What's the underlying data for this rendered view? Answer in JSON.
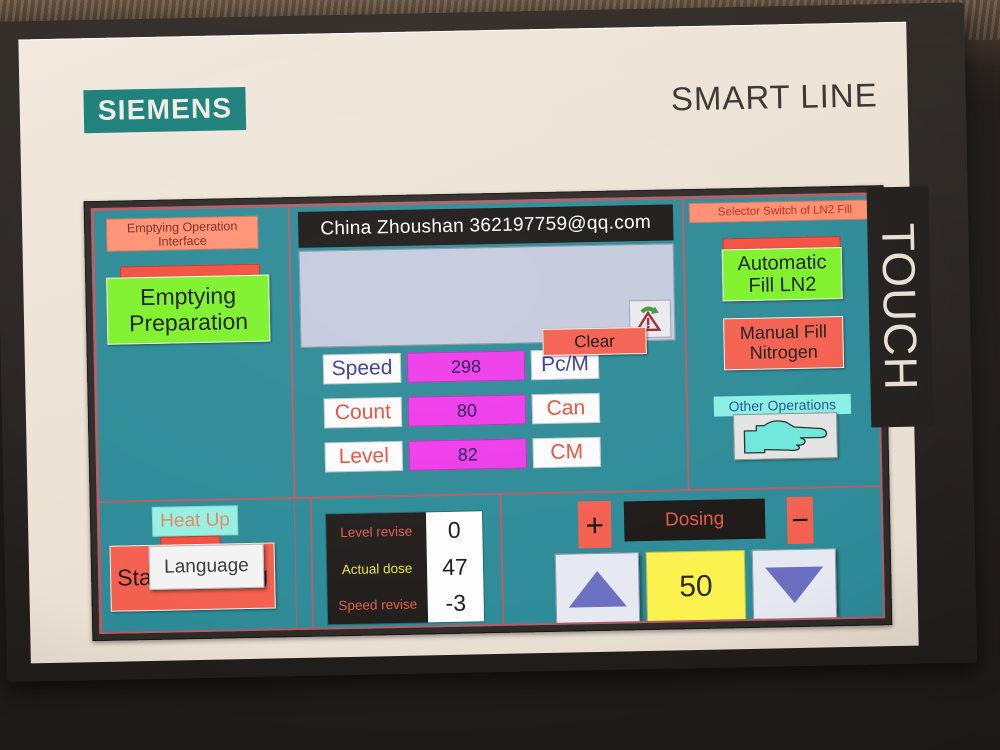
{
  "device": {
    "brand": "SIEMENS",
    "product_line": "SMART LINE",
    "side_label": "TOUCH"
  },
  "screen": {
    "header": {
      "title": "China  Zhoushan   362197759@qq.com"
    },
    "alarm_view": {
      "ack_icon": "warning-refresh-icon",
      "content": ""
    },
    "left_panel": {
      "section_title": "Emptying Operation Interface",
      "prepare_button": "Emptying Preparation",
      "heat_up_label": "Heat Up",
      "start_button": "Start Emptying"
    },
    "readouts": [
      {
        "key": "Speed",
        "value": "298",
        "unit": "Pc/M",
        "key_color": "#3b3b9e"
      },
      {
        "key": "Count",
        "value": "80",
        "unit": "Can",
        "key_color": "#e2523f"
      },
      {
        "key": "Level",
        "value": "82",
        "unit": "CM",
        "key_color": "#e2523f"
      }
    ],
    "clear_button": "Clear",
    "right_panel": {
      "section_title": "Selector Switch of LN2 Fill",
      "auto_button": "Automatic Fill LN2",
      "manual_button": "Manual Fill Nitrogen",
      "other_ops_label": "Other Operations",
      "other_ops_icon": "pointing-hand-icon"
    },
    "bottom": {
      "language_button": "Language",
      "revise_rows": [
        {
          "label": "Level revise",
          "value": "0",
          "label_color": "#e2614e"
        },
        {
          "label": "Actual dose",
          "value": "47",
          "label_color": "#ece44a"
        },
        {
          "label": "Speed revise",
          "value": "-3",
          "label_color": "#e2614e"
        }
      ],
      "dosing": {
        "plus": "+",
        "minus": "−",
        "title": "Dosing",
        "value": "50",
        "up_icon": "triangle-up-icon",
        "down_icon": "triangle-down-icon"
      }
    }
  },
  "colors": {
    "screen_bg": "#2d8b97",
    "frame": "#c05a63",
    "green_button": "#7ef22b",
    "red_button": "#f4604f",
    "magenta_field": "#ef3bea",
    "cyan_chip": "#96f0e4",
    "yellow_field": "#fbf24f",
    "siemens_teal": "#1c7f7b"
  }
}
